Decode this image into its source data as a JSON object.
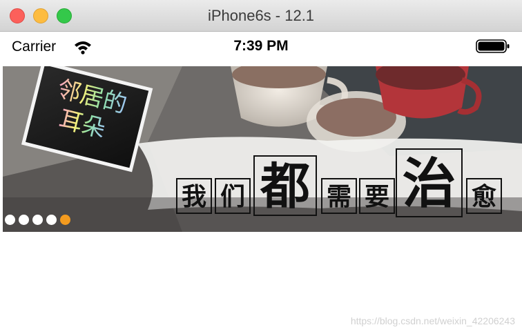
{
  "window": {
    "title": "iPhone6s - 12.1"
  },
  "status_bar": {
    "carrier": "Carrier",
    "time": "7:39 PM",
    "battery_level": 1.0,
    "icons": [
      "wifi-icon",
      "battery-icon"
    ]
  },
  "banner": {
    "card_line1": "邻居的",
    "card_line2": "耳朵",
    "slogan": [
      "我",
      "们",
      "都",
      "需",
      "要",
      "治",
      "愈"
    ],
    "page_count": 5,
    "active_page": 4,
    "dot_color": "#ffffff",
    "active_dot_color": "#f39b1f"
  },
  "watermark": "https://blog.csdn.net/weixin_42206243"
}
